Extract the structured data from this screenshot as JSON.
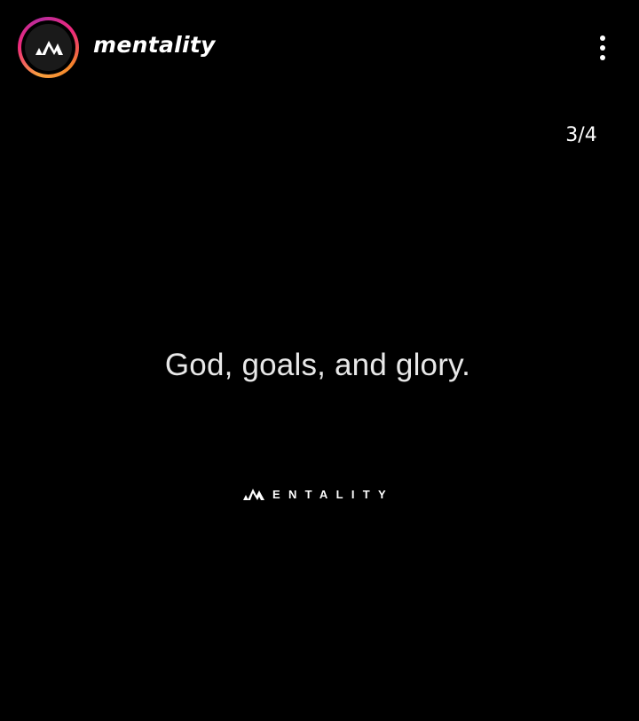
{
  "header": {
    "username": "mentality",
    "avatar_icon": "mentality-logo-icon",
    "more_icon": "more-vertical-icon",
    "ring_colors": [
      "#f9a03f",
      "#ee2a7b",
      "#b92b9d",
      "#f58529"
    ]
  },
  "slide": {
    "counter": "3/4",
    "quote": "God, goals, and glory.",
    "brand_text": "ENTALITY",
    "brand_icon": "mentality-m-logo-icon",
    "background": "#000000"
  }
}
